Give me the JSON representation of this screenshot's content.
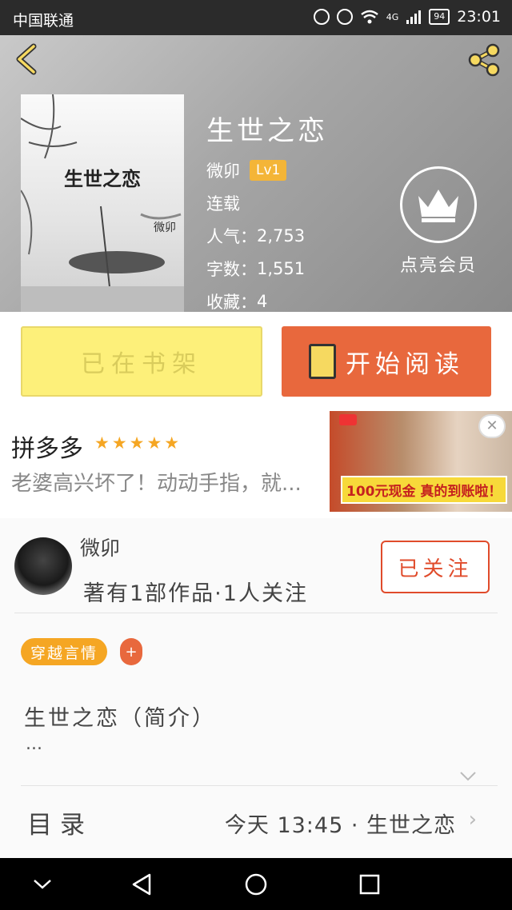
{
  "status_bar": {
    "carrier": "中国联通",
    "network": "4G",
    "battery": "94",
    "time": "23:01"
  },
  "book": {
    "title": "生世之恋",
    "cover_title": "生世之恋",
    "cover_author": "微卯",
    "author": "微卯",
    "level": "Lv1",
    "status": "连载",
    "popularity_label": "人气：",
    "popularity": "2,753",
    "words_label": "字数：",
    "words": "1,551",
    "favorites_label": "收藏：",
    "favorites": "4"
  },
  "vip": {
    "label": "点亮会员",
    "icon": "crown-icon"
  },
  "actions": {
    "shelf_label": "已在书架",
    "read_label": "开始阅读",
    "read_icon": "book-icon"
  },
  "ad": {
    "title": "拼多多",
    "stars": "★★★★★",
    "text": "老婆高兴坏了！动动手指，就...",
    "badge": "100元现金 真的到账啦！",
    "close": "✕"
  },
  "author_panel": {
    "name": "微卯",
    "stats": "著有1部作品·1人关注",
    "follow_label": "已关注",
    "tag": "穿越言情",
    "tag_add": "+",
    "synopsis": "生世之恋（简介）",
    "synopsis_more": "...",
    "expand_icon": "chevron-down-icon"
  },
  "toc": {
    "label": "目录",
    "latest": "今天 13:45 · 生世之恋",
    "arrow": "›"
  },
  "colors": {
    "accent": "#e8683d",
    "shelf": "#fdf07a",
    "tag": "#f5a623",
    "follow": "#e04b2b"
  }
}
